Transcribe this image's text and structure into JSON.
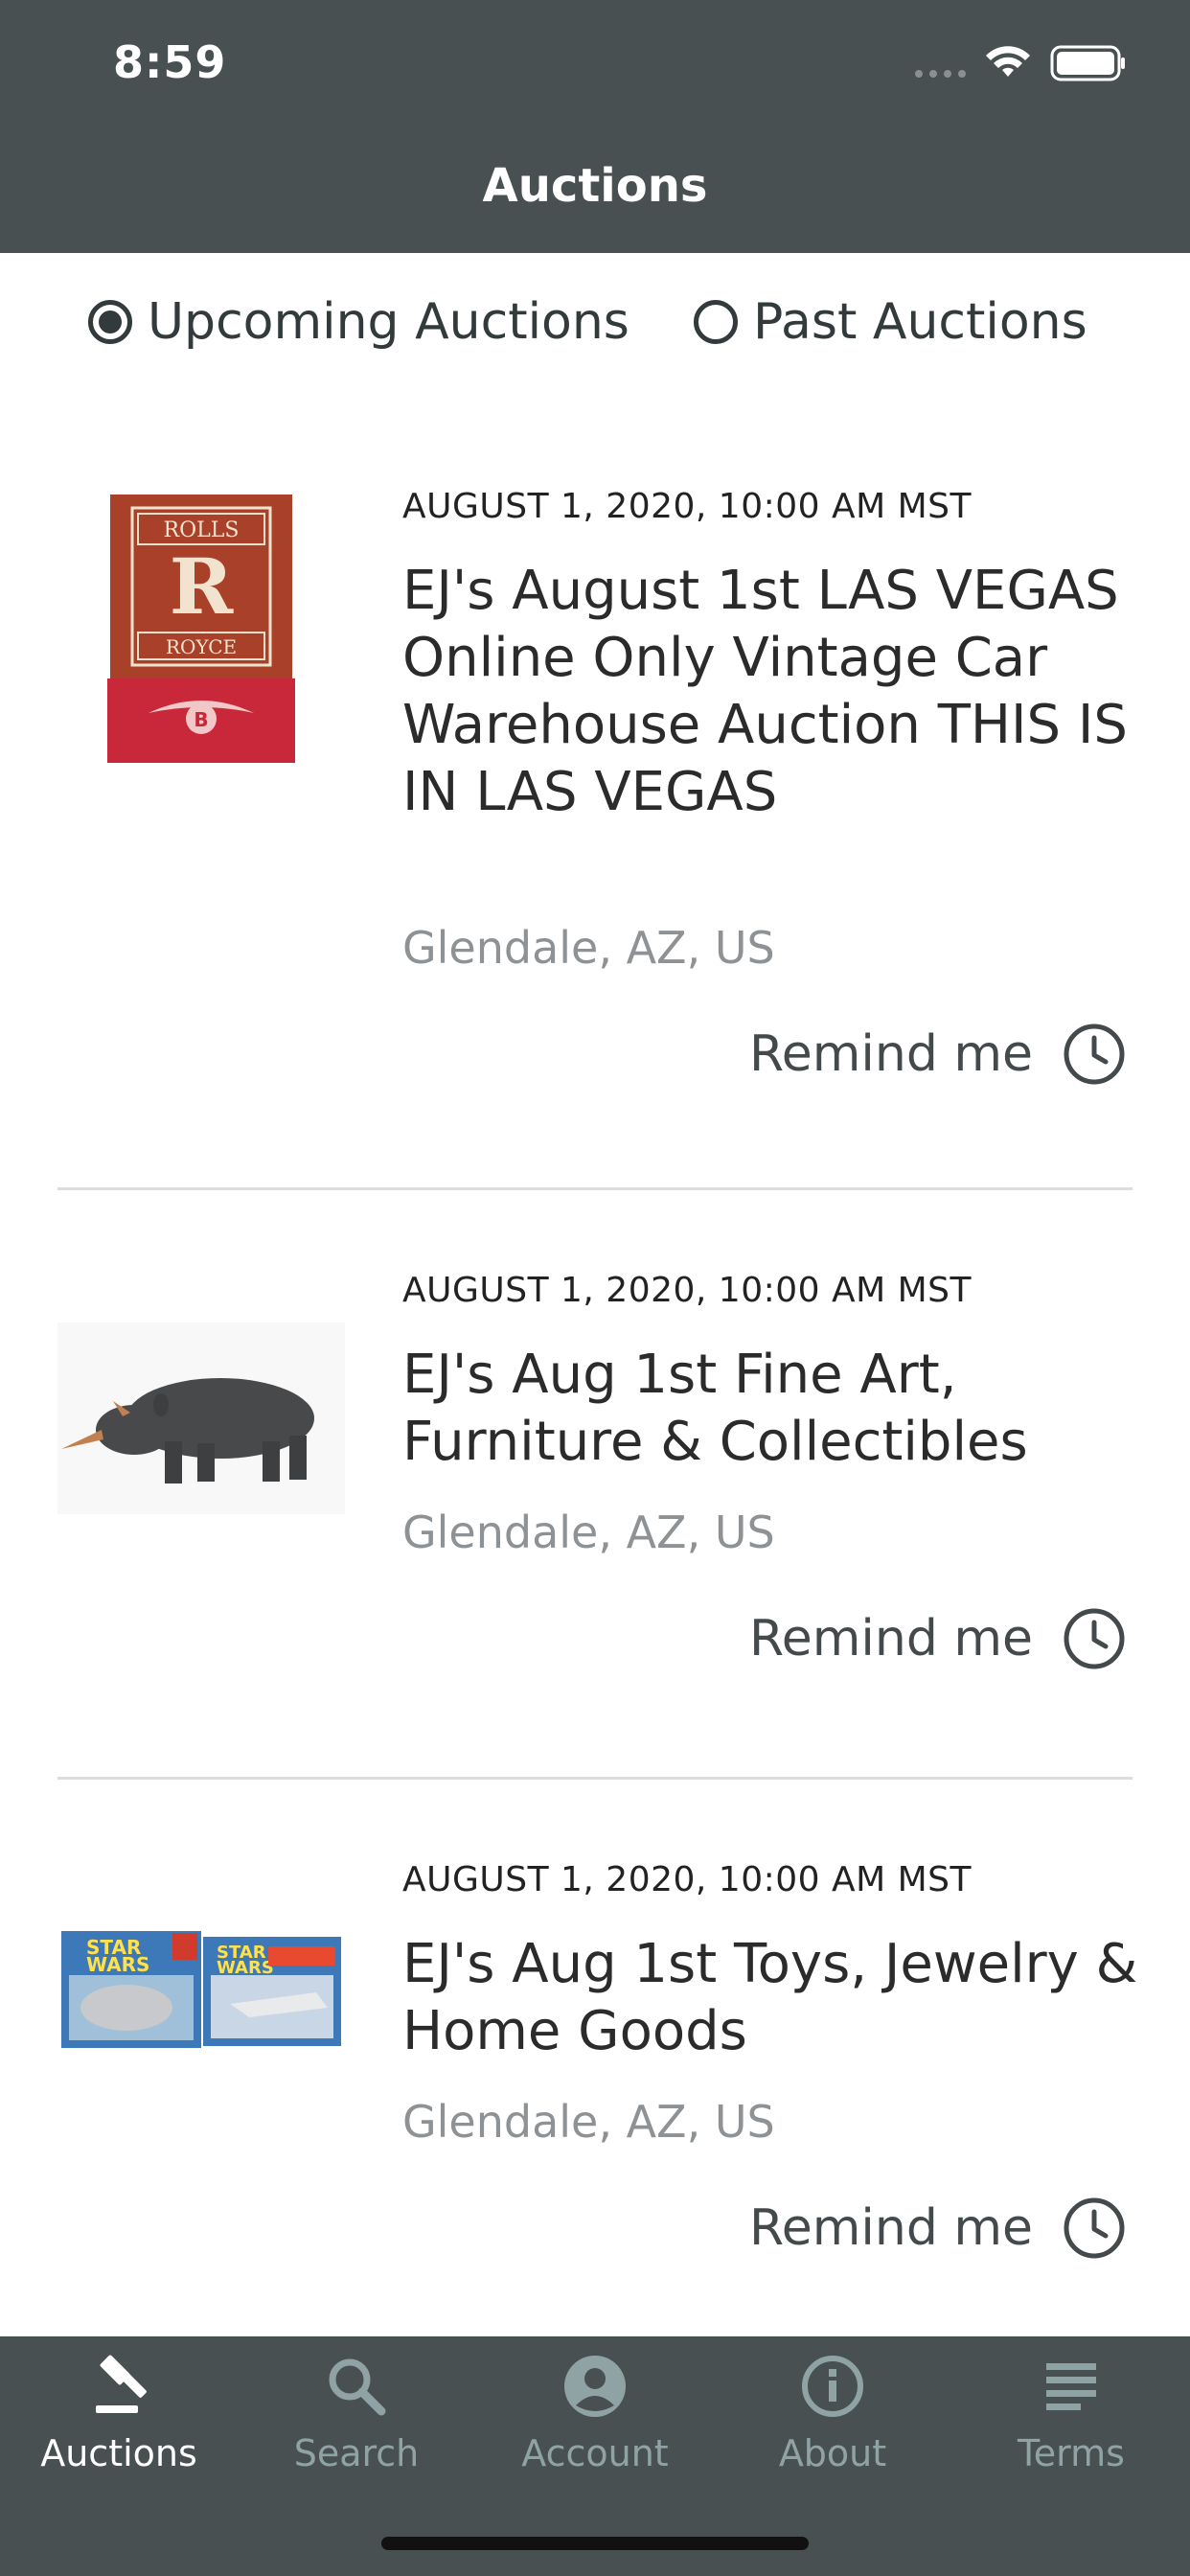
{
  "status_bar": {
    "time": "8:59"
  },
  "header": {
    "title": "Auctions"
  },
  "filter": {
    "options": [
      {
        "label": "Upcoming Auctions",
        "selected": true
      },
      {
        "label": "Past Auctions",
        "selected": false
      }
    ]
  },
  "auctions": [
    {
      "date": "AUGUST 1, 2020, 10:00 AM MST",
      "title": "EJ's August 1st LAS VEGAS Online Only Vintage Car Warehouse Auction THIS IS IN LAS VEGAS",
      "location": "Glendale, AZ, US",
      "remind_label": "Remind me",
      "image": "rolls-royce-bentley-flag",
      "image_text": [
        "ROLLS",
        "ROYCE",
        "B"
      ]
    },
    {
      "date": "AUGUST 1, 2020, 10:00 AM MST",
      "title": "EJ's Aug 1st Fine Art, Furniture & Collectibles",
      "location": "Glendale, AZ, US",
      "remind_label": "Remind me",
      "image": "rhino-sculpture"
    },
    {
      "date": "AUGUST 1, 2020, 10:00 AM MST",
      "title": "EJ's Aug 1st Toys, Jewelry & Home Goods",
      "location": "Glendale, AZ, US",
      "remind_label": "Remind me",
      "image": "star-wars-toy-boxes",
      "image_text": [
        "STAR",
        "WARS"
      ]
    }
  ],
  "tab_bar": {
    "tabs": [
      {
        "label": "Auctions",
        "icon": "gavel-icon",
        "active": true
      },
      {
        "label": "Search",
        "icon": "search-icon",
        "active": false
      },
      {
        "label": "Account",
        "icon": "account-icon",
        "active": false
      },
      {
        "label": "About",
        "icon": "info-icon",
        "active": false
      },
      {
        "label": "Terms",
        "icon": "terms-icon",
        "active": false
      }
    ]
  },
  "colors": {
    "header_bg": "#495052",
    "tab_inactive": "#8fa3a5",
    "text": "#2b2b2b",
    "location": "#8e9294"
  }
}
